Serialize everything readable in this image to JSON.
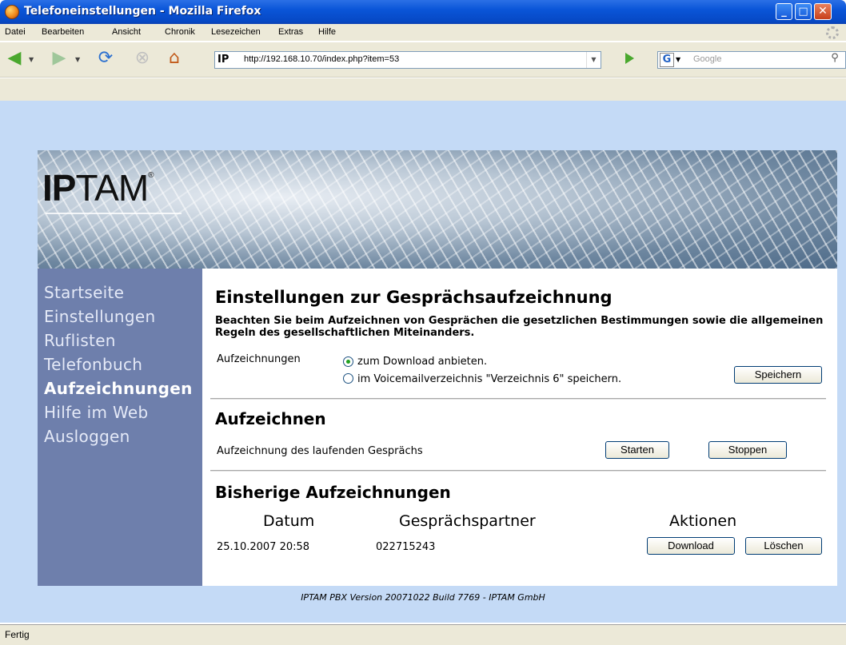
{
  "window": {
    "title": "Telefoneinstellungen - Mozilla Firefox"
  },
  "menu": [
    "Datei",
    "Bearbeiten",
    "Ansicht",
    "Chronik",
    "Lesezeichen",
    "Extras",
    "Hilfe"
  ],
  "toolbar": {
    "url": "http://192.168.10.70/index.php?item=53",
    "site_icon": "IP",
    "search_engine": "G",
    "search_placeholder": "Google"
  },
  "banner": {
    "logo_bold": "IP",
    "logo_rest": "TAM",
    "logo_mark": "®"
  },
  "sidebar": {
    "items": [
      {
        "label": "Startseite",
        "active": false
      },
      {
        "label": "Einstellungen",
        "active": false
      },
      {
        "label": "Ruflisten",
        "active": false
      },
      {
        "label": "Telefonbuch",
        "active": false
      },
      {
        "label": "Aufzeichnungen",
        "active": true
      },
      {
        "label": "Hilfe im Web",
        "active": false
      },
      {
        "label": "Ausloggen",
        "active": false
      }
    ]
  },
  "settings": {
    "heading": "Einstellungen zur Gesprächsaufzeichnung",
    "note": "Beachten Sie beim Aufzeichnen von Gesprächen die gesetzlichen Bestimmungen sowie die allgemeinen Regeln des gesellschaftlichen Miteinanders.",
    "label": "Aufzeichnungen",
    "option_download": "zum Download anbieten.",
    "option_voicemail": "im Voicemailverzeichnis \"Verzeichnis 6\" speichern.",
    "selected": "download",
    "save_button": "Speichern"
  },
  "record": {
    "heading": "Aufzeichnen",
    "label": "Aufzeichnung des laufenden Gesprächs",
    "start_button": "Starten",
    "stop_button": "Stoppen"
  },
  "history": {
    "heading": "Bisherige Aufzeichnungen",
    "columns": [
      "Datum",
      "Gesprächspartner",
      "Aktionen"
    ],
    "rows": [
      {
        "date": "25.10.2007 20:58",
        "partner": "022715243",
        "download": "Download",
        "delete": "Löschen"
      }
    ]
  },
  "footer": "IPTAM PBX Version 20071022 Build 7769 - IPTAM GmbH",
  "status": "Fertig"
}
